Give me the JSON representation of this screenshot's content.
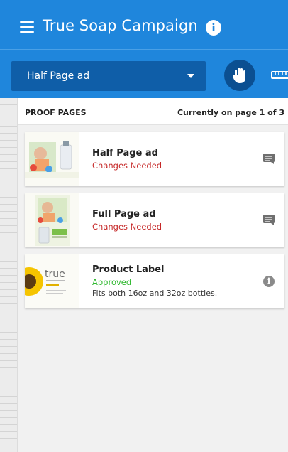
{
  "app": {
    "title": "True Soap Campaign"
  },
  "toolbar": {
    "selected_page": "Half Page ad"
  },
  "proof": {
    "header_label": "PROOF PAGES",
    "page_status": "Currently on page 1 of 3"
  },
  "pages": [
    {
      "title": "Half Page ad",
      "status": "Changes Needed",
      "status_color": "#c62828",
      "icon": "comment-icon"
    },
    {
      "title": "Full Page ad",
      "status": "Changes Needed",
      "status_color": "#c62828",
      "icon": "comment-icon"
    },
    {
      "title": "Product Label",
      "status": "Approved",
      "status_color": "#2eb82e",
      "note": "Fits both 16oz and 32oz bottles.",
      "icon": "info-icon",
      "thumb_text": "true"
    }
  ],
  "colors": {
    "header_blue": "#1f86dc",
    "select_blue": "#0f5ea8",
    "hand_button": "#0b4f91"
  }
}
